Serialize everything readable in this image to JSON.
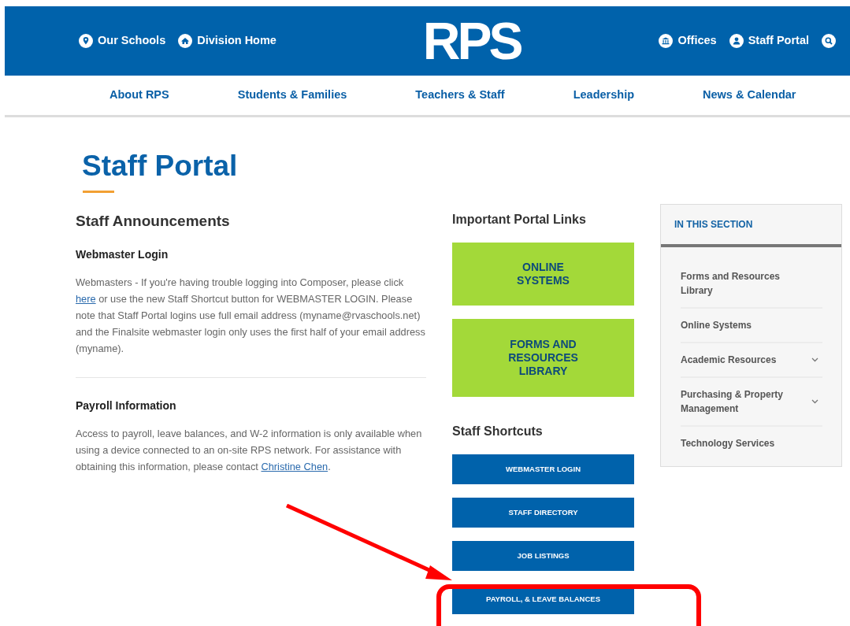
{
  "header": {
    "left_links": [
      {
        "kind": "pin",
        "label": "Our Schools"
      },
      {
        "kind": "home",
        "label": "Division Home"
      }
    ],
    "logo": "RPS",
    "right_links": [
      {
        "kind": "building",
        "label": "Offices"
      },
      {
        "kind": "person",
        "label": "Staff Portal"
      }
    ]
  },
  "main_nav": [
    "About RPS",
    "Students & Families",
    "Teachers & Staff",
    "Leadership",
    "News & Calendar"
  ],
  "page_title": "Staff Portal",
  "announcements": {
    "heading": "Staff Announcements",
    "items": [
      {
        "title": "Webmaster Login",
        "text_before": "Webmasters - If you're having trouble logging into Composer, please click",
        "link": "here",
        "text_after": "or use the new Staff Shortcut button for WEBMASTER LOGIN. Please note that Staff Portal logins use full email address (myname@rvaschools.net) and the Finalsite webmaster login only uses the first half of your email address (myname)."
      },
      {
        "title": "Payroll Information",
        "text_before": "Access to payroll, leave balances, and W-2 information is only available when using a device connected to an on-site RPS network. For assistance with obtaining this information, please contact",
        "link": "Christine Chen",
        "text_after": "."
      }
    ]
  },
  "portal_links": {
    "heading": "Important Portal Links",
    "buttons": [
      "ONLINE SYSTEMS",
      "FORMS AND RESOURCES LIBRARY"
    ]
  },
  "shortcuts": {
    "heading": "Staff Shortcuts",
    "buttons": [
      {
        "label": "WEBMASTER LOGIN",
        "highlighted": false
      },
      {
        "label": "STAFF DIRECTORY",
        "highlighted": false
      },
      {
        "label": "JOB LISTINGS",
        "highlighted": false
      },
      {
        "label": "PAYROLL, & LEAVE BALANCES",
        "highlighted": true
      }
    ]
  },
  "sidebar": {
    "heading": "IN THIS SECTION",
    "items": [
      {
        "label": "Forms and Resources Library",
        "expandable": false
      },
      {
        "label": "Online Systems",
        "expandable": false
      },
      {
        "label": "Academic Resources",
        "expandable": true
      },
      {
        "label": "Purchasing & Property Management",
        "expandable": true
      },
      {
        "label": "Technology Services",
        "expandable": false
      }
    ]
  }
}
